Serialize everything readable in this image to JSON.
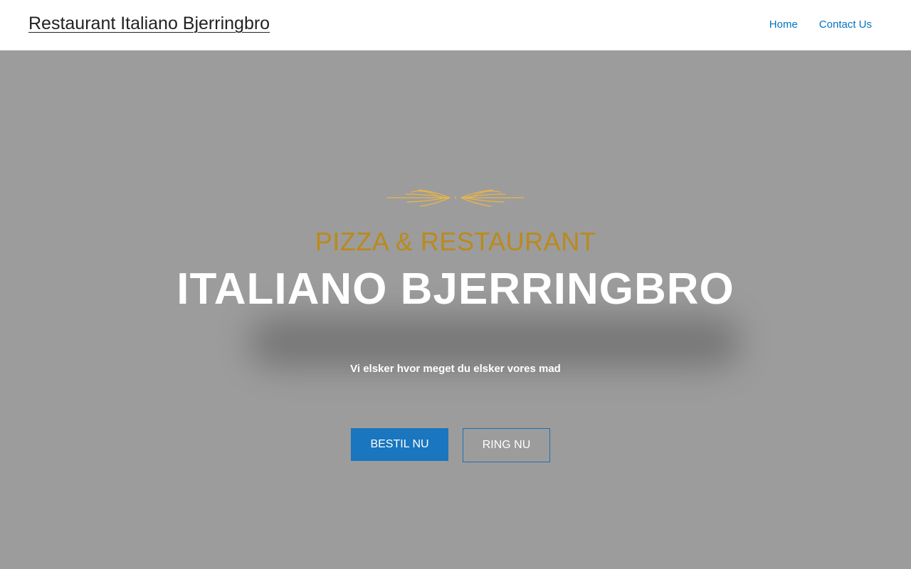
{
  "header": {
    "site_title": "Restaurant Italiano Bjerringbro",
    "nav": [
      {
        "label": "Home"
      },
      {
        "label": "Contact Us"
      }
    ]
  },
  "hero": {
    "ornament_icon": "wheat-ornament-icon",
    "subtitle": "PIZZA & RESTAURANT",
    "title": "ITALIANO BJERRINGBRO",
    "tagline": "Vi elsker hvor meget du elsker vores mad",
    "primary_button": "BESTIL NU",
    "secondary_button": "RING NU"
  },
  "colors": {
    "accent_gold": "#bb8a1a",
    "ornament_gold": "#e8b54a",
    "link_blue": "#0274be",
    "button_blue": "#1976bf",
    "hero_background": "#9c9c9c"
  }
}
